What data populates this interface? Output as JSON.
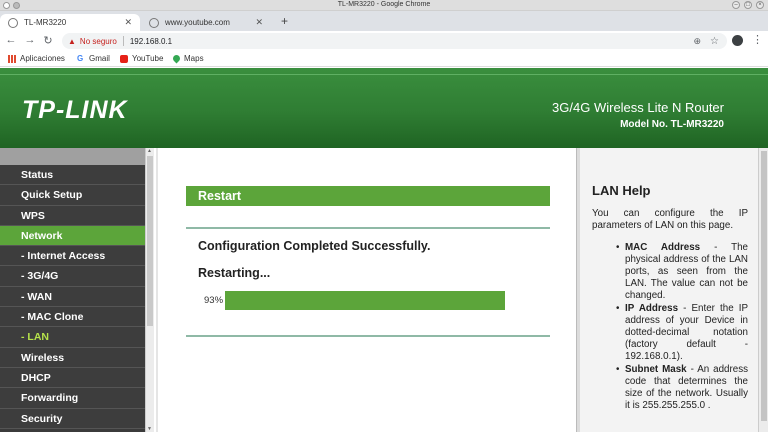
{
  "window": {
    "title": "TL-MR3220 - Google Chrome"
  },
  "tabs": [
    {
      "label": "TL-MR3220",
      "active": true
    },
    {
      "label": "www.youtube.com",
      "active": false
    }
  ],
  "address_bar": {
    "security": "No seguro",
    "url": "192.168.0.1"
  },
  "bookmarks": [
    {
      "label": "Aplicaciones",
      "icon": "apps-grid-icon"
    },
    {
      "label": "Gmail",
      "icon": "google-icon"
    },
    {
      "label": "YouTube",
      "icon": "youtube-icon"
    },
    {
      "label": "Maps",
      "icon": "maps-pin-icon"
    }
  ],
  "banner": {
    "logo": "TP-LINK",
    "product": "3G/4G Wireless Lite N Router",
    "model": "Model No. TL-MR3220"
  },
  "sidebar": {
    "items": [
      {
        "label": "Status",
        "type": "top"
      },
      {
        "label": "Quick Setup",
        "type": "top"
      },
      {
        "label": "WPS",
        "type": "top"
      },
      {
        "label": "Network",
        "type": "top",
        "active": true
      },
      {
        "label": "- Internet Access",
        "type": "sub"
      },
      {
        "label": "- 3G/4G",
        "type": "sub"
      },
      {
        "label": "- WAN",
        "type": "sub"
      },
      {
        "label": "- MAC Clone",
        "type": "sub"
      },
      {
        "label": "- LAN",
        "type": "sub",
        "current": true
      },
      {
        "label": "Wireless",
        "type": "top"
      },
      {
        "label": "DHCP",
        "type": "top"
      },
      {
        "label": "Forwarding",
        "type": "top"
      },
      {
        "label": "Security",
        "type": "top"
      }
    ]
  },
  "main": {
    "section_title": "Restart",
    "message": "Configuration Completed Successfully.",
    "status": "Restarting...",
    "progress_text": "93%",
    "progress_value": 0.93
  },
  "help": {
    "title": "LAN Help",
    "intro": "You can configure the IP parameters of LAN on this page.",
    "items": [
      {
        "term": "MAC Address",
        "text": " - The physical address of the LAN ports, as seen from the LAN. The value can not be changed."
      },
      {
        "term": "IP Address",
        "text": " - Enter the IP address of your Device in dotted-decimal notation (factory default - 192.168.0.1)."
      },
      {
        "term": "Subnet Mask",
        "text": " - An address code that determines the size of the network. Usually it is 255.255.255.0 ."
      }
    ]
  },
  "colors": {
    "brand_green": "#5ca53a",
    "banner_green": "#2f7d33",
    "sidebar_bg": "#3d3d3d",
    "current_item": "#b6e24a"
  }
}
